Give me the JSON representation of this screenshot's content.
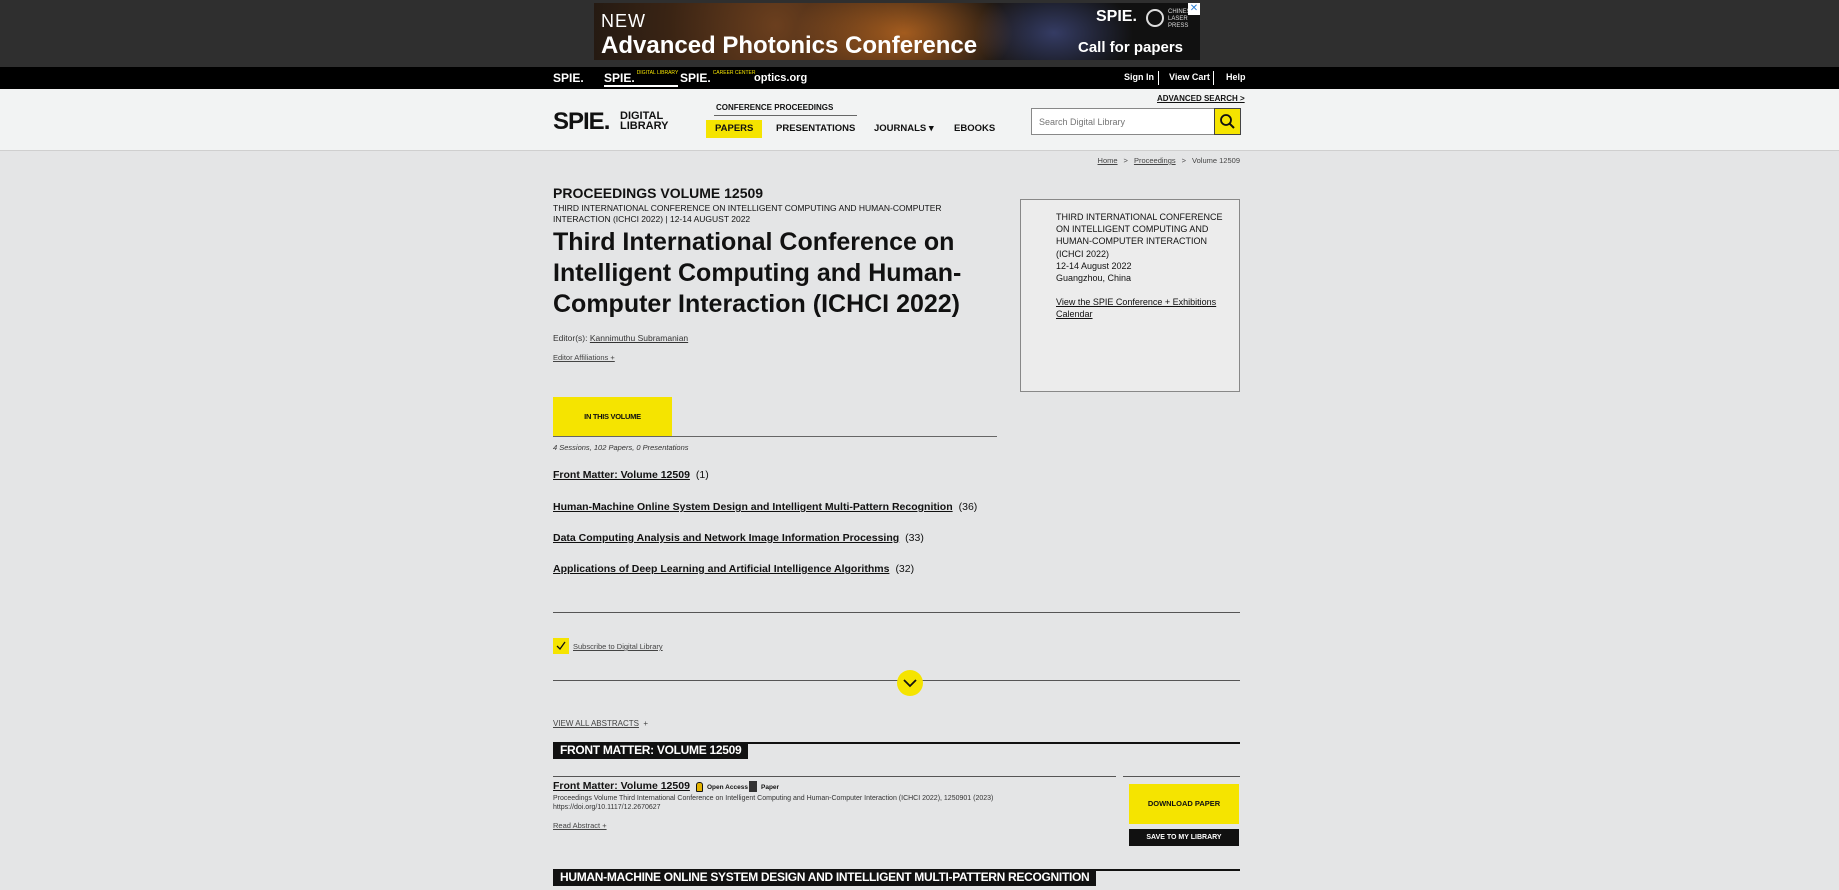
{
  "ad": {
    "new_label": "NEW",
    "title": "Advanced Photonics Conference",
    "brand": "SPIE.",
    "partner_text": "CHINESE LASER PRESS",
    "cta": "Call for papers",
    "close": "✕"
  },
  "topnav": {
    "brands": [
      {
        "label": "SPIE.",
        "sub": ""
      },
      {
        "label": "SPIE.",
        "sub": "DIGITAL LIBRARY"
      },
      {
        "label": "SPIE.",
        "sub": "CAREER CENTER"
      }
    ],
    "optics": "optics.org",
    "sign_in": "Sign In",
    "view_cart": "View Cart",
    "help": "Help"
  },
  "header": {
    "logo": "SPIE.",
    "logo_sub_1": "DIGITAL",
    "logo_sub_2": "LIBRARY",
    "conf_proc_label": "CONFERENCE PROCEEDINGS",
    "tabs": [
      {
        "label": "PAPERS",
        "active": true
      },
      {
        "label": "PRESENTATIONS",
        "active": false
      },
      {
        "label": "JOURNALS ▾",
        "active": false
      },
      {
        "label": "EBOOKS",
        "active": false
      }
    ],
    "advanced_search": "ADVANCED SEARCH >",
    "search_placeholder": "Search Digital Library"
  },
  "breadcrumb": [
    "Home",
    "Proceedings",
    "Volume 12509"
  ],
  "volume": {
    "label": "PROCEEDINGS VOLUME 12509",
    "subtitle": "THIRD INTERNATIONAL CONFERENCE ON INTELLIGENT COMPUTING AND HUMAN-COMPUTER INTERACTION (ICHCI 2022) | 12-14 AUGUST 2022",
    "title": "Third International Conference on Intelligent Computing and Human-Computer Interaction (ICHCI 2022)",
    "editors_label": "Editor(s):",
    "editor_name": "Kannimuthu Subramanian",
    "editor_affiliations": "Editor Affiliations +"
  },
  "info_box": {
    "conf_name": "THIRD INTERNATIONAL CONFERENCE ON INTELLIGENT COMPUTING AND HUMAN-COMPUTER INTERACTION (ICHCI 2022)",
    "dates": "12-14 August 2022",
    "location": "Guangzhou, China",
    "calendar_link": "View the SPIE Conference + Exhibitions Calendar"
  },
  "in_volume": {
    "button": "IN THIS VOLUME",
    "summary": "4 Sessions, 102 Papers, 0 Presentations"
  },
  "sessions": [
    {
      "title": "Front Matter: Volume 12509",
      "count": "(1)"
    },
    {
      "title": "Human-Machine Online System Design and Intelligent Multi-Pattern Recognition",
      "count": "(36)"
    },
    {
      "title": "Data Computing Analysis and Network Image Information Processing",
      "count": "(33)"
    },
    {
      "title": "Applications of Deep Learning and Artificial Intelligence Algorithms",
      "count": "(32)"
    }
  ],
  "subscribe": "Subscribe to Digital Library",
  "view_all_abstracts": "VIEW ALL ABSTRACTS",
  "view_all_plus": "+",
  "section_1": "FRONT MATTER: VOLUME 12509",
  "paper": {
    "title": "Front Matter: Volume 12509",
    "open_access": "Open Access",
    "type": "Paper",
    "citation": "Proceedings Volume Third International Conference on Intelligent Computing and Human-Computer Interaction (ICHCI 2022), 1250901 (2023)",
    "doi": "https://doi.org/10.1117/12.2670627",
    "read_abstract": "Read Abstract +",
    "download": "DOWNLOAD PAPER",
    "save": "SAVE TO MY LIBRARY"
  },
  "section_2": "HUMAN-MACHINE ONLINE SYSTEM DESIGN AND INTELLIGENT MULTI-PATTERN RECOGNITION",
  "colors": {
    "accent_yellow": "#f5e400",
    "dark": "#111111"
  }
}
